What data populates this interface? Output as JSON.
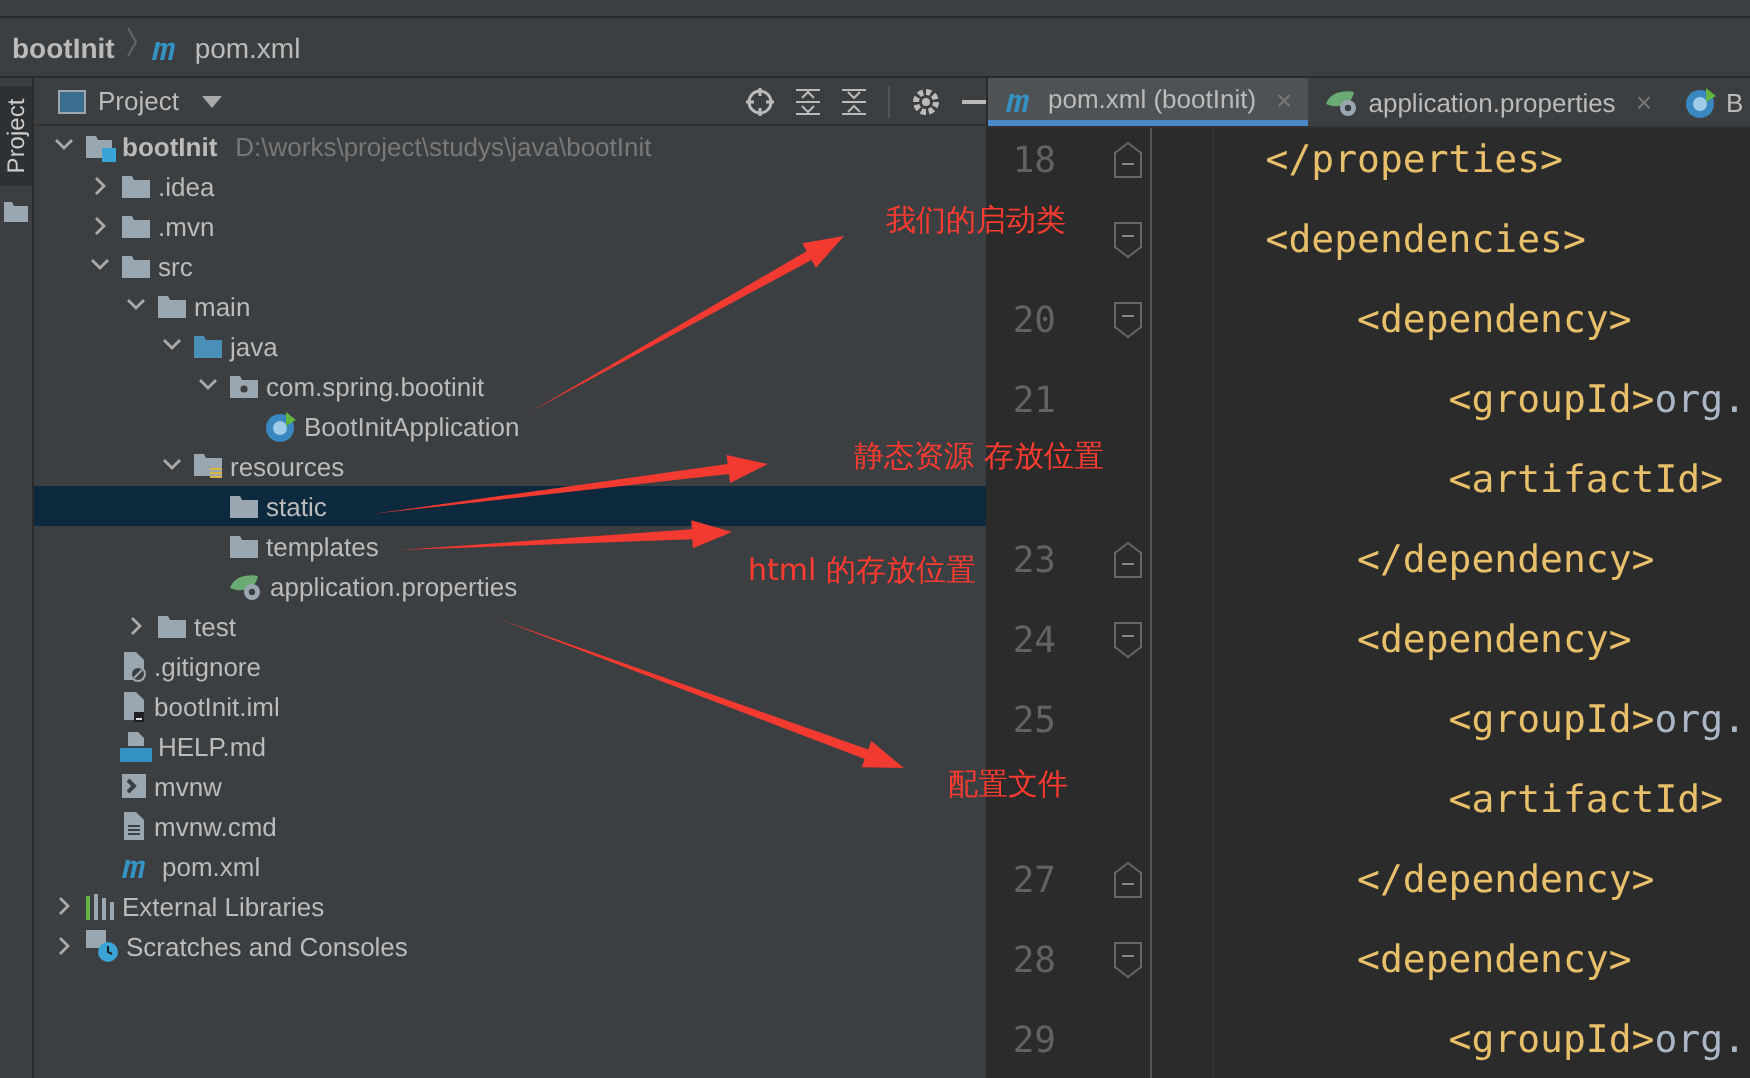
{
  "breadcrumb": [
    {
      "label": "bootInit",
      "kind": "module"
    },
    {
      "label": "pom.xml",
      "kind": "maven"
    }
  ],
  "side_tab": {
    "label": "Project"
  },
  "project_panel": {
    "title": "Project"
  },
  "tree": [
    {
      "label": "bootInit",
      "kind": "module",
      "path": "D:\\works\\project\\studys\\java\\bootInit",
      "expanded": true,
      "selected": false,
      "children": [
        {
          "label": ".idea",
          "kind": "folder",
          "expanded": false,
          "selected": false
        },
        {
          "label": ".mvn",
          "kind": "folder",
          "expanded": false,
          "selected": false
        },
        {
          "label": "src",
          "kind": "folder",
          "expanded": true,
          "selected": false,
          "children": [
            {
              "label": "main",
              "kind": "folder",
              "expanded": true,
              "selected": false,
              "children": [
                {
                  "label": "java",
                  "kind": "source-folder",
                  "expanded": true,
                  "selected": false,
                  "children": [
                    {
                      "label": "com.spring.bootinit",
                      "kind": "package",
                      "expanded": true,
                      "selected": false,
                      "children": [
                        {
                          "label": "BootInitApplication",
                          "kind": "spring-class",
                          "selected": false
                        }
                      ]
                    }
                  ]
                },
                {
                  "label": "resources",
                  "kind": "resources-folder",
                  "expanded": true,
                  "selected": false,
                  "children": [
                    {
                      "label": "static",
                      "kind": "folder",
                      "selected": true
                    },
                    {
                      "label": "templates",
                      "kind": "folder",
                      "selected": false
                    },
                    {
                      "label": "application.properties",
                      "kind": "spring-config",
                      "selected": false
                    }
                  ]
                }
              ]
            },
            {
              "label": "test",
              "kind": "folder",
              "expanded": false,
              "selected": false
            }
          ]
        },
        {
          "label": ".gitignore",
          "kind": "ignore-file",
          "selected": false
        },
        {
          "label": "bootInit.iml",
          "kind": "iml-file",
          "selected": false
        },
        {
          "label": "HELP.md",
          "kind": "markdown-file",
          "selected": false
        },
        {
          "label": "mvnw",
          "kind": "shell-file",
          "selected": false
        },
        {
          "label": "mvnw.cmd",
          "kind": "text-file",
          "selected": false
        },
        {
          "label": "pom.xml",
          "kind": "maven",
          "selected": false
        }
      ]
    },
    {
      "label": "External Libraries",
      "kind": "libraries",
      "expanded": false,
      "selected": false
    },
    {
      "label": "Scratches and Consoles",
      "kind": "scratches",
      "expanded": false,
      "selected": false
    }
  ],
  "editor": {
    "tabs": [
      {
        "label": "pom.xml (bootInit)",
        "kind": "maven",
        "selected": true,
        "close": "×"
      },
      {
        "label": "application.properties",
        "kind": "spring-config",
        "selected": false,
        "close": "×"
      },
      {
        "label": "B",
        "kind": "spring-class",
        "selected": false
      }
    ],
    "lines": [
      {
        "number": "18",
        "code": "    </properties>",
        "kind": "fold-end"
      },
      {
        "code": "    <dependencies>",
        "kind": "fold-start"
      },
      {
        "number": "20",
        "code": "        <dependency>",
        "kind": "fold-start"
      },
      {
        "number": "21",
        "code": "            <groupId>",
        "value": "org.",
        "kind": "plain"
      },
      {
        "code": "            <artifactId>",
        "kind": "plain"
      },
      {
        "number": "23",
        "code": "        </dependency>",
        "kind": "fold-end"
      },
      {
        "number": "24",
        "code": "        <dependency>",
        "kind": "fold-start"
      },
      {
        "number": "25",
        "code": "            <groupId>",
        "value": "org.",
        "kind": "plain"
      },
      {
        "code": "            <artifactId>",
        "kind": "plain"
      },
      {
        "number": "27",
        "code": "        </dependency>",
        "kind": "fold-end"
      },
      {
        "number": "28",
        "code": "        <dependency>",
        "kind": "fold-start"
      },
      {
        "number": "29",
        "code": "            <groupId>",
        "value": "org.",
        "kind": "plain"
      }
    ]
  },
  "annotations": [
    {
      "text": "我们的启动类"
    },
    {
      "text": "静态资源 存放位置"
    },
    {
      "text": "html 的存放位置"
    },
    {
      "text": "配置文件"
    }
  ]
}
